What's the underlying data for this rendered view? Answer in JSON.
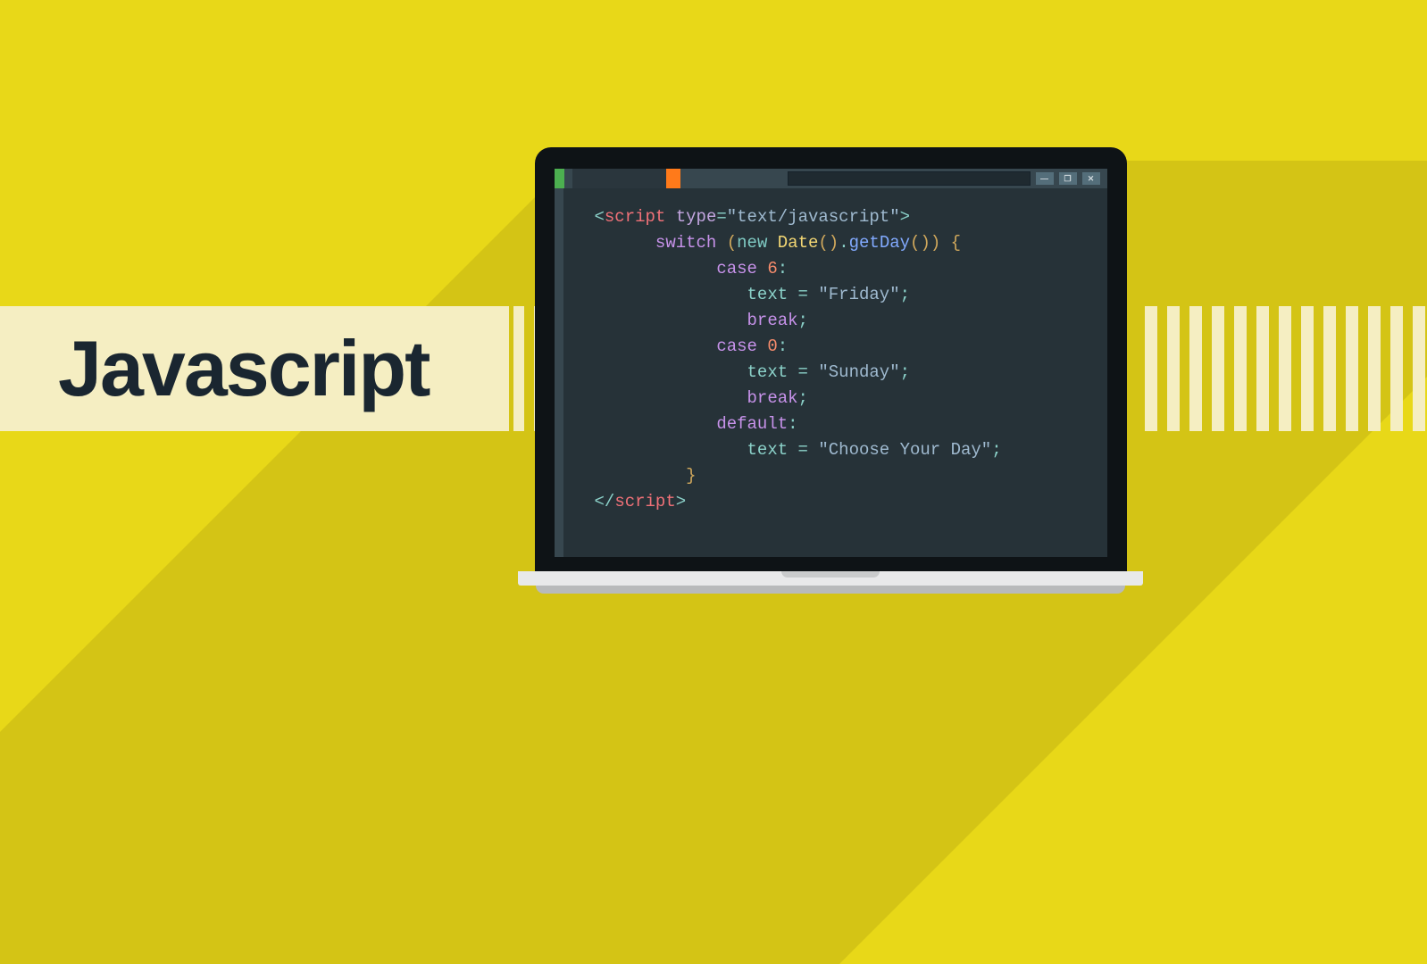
{
  "title": "Javascript",
  "window_buttons": {
    "minimize": "—",
    "maximize": "❐",
    "close": "✕"
  },
  "code": {
    "l1": {
      "open": "<",
      "tag": "script",
      "sp": " ",
      "attr": "type",
      "eq": "=",
      "q1": "\"",
      "val": "text/javascript",
      "q2": "\"",
      "close": ">"
    },
    "l2": {
      "kw": "switch",
      "sp": " ",
      "lp": "(",
      "new": "new",
      "sp2": " ",
      "cls": "Date",
      "lp2": "(",
      "rp2": ")",
      "dot": ".",
      "method": "getDay",
      "lp3": "(",
      "rp3": ")",
      "rp": ")",
      "sp3": " ",
      "brace": "{"
    },
    "l3": {
      "kw": "case",
      "sp": " ",
      "num": "6",
      "colon": ":"
    },
    "l4": {
      "var": "text",
      "sp": " ",
      "eq": "=",
      "sp2": " ",
      "q1": "\"",
      "str": "Friday",
      "q2": "\"",
      "semi": ";"
    },
    "l5": {
      "kw": "break",
      "semi": ";"
    },
    "l6": {
      "kw": "case",
      "sp": " ",
      "num": "0",
      "colon": ":"
    },
    "l7": {
      "var": "text",
      "sp": " ",
      "eq": "=",
      "sp2": " ",
      "q1": "\"",
      "str": "Sunday",
      "q2": "\"",
      "semi": ";"
    },
    "l8": {
      "kw": "break",
      "semi": ";"
    },
    "l9": {
      "kw": "default",
      "colon": ":"
    },
    "l10": {
      "var": "text",
      "sp": " ",
      "eq": "=",
      "sp2": " ",
      "q1": "\"",
      "str": "Choose Your Day",
      "q2": "\"",
      "semi": ";"
    },
    "l11": {
      "brace": "}"
    },
    "l12": {
      "open": "</",
      "tag": "script",
      "close": ">"
    }
  }
}
